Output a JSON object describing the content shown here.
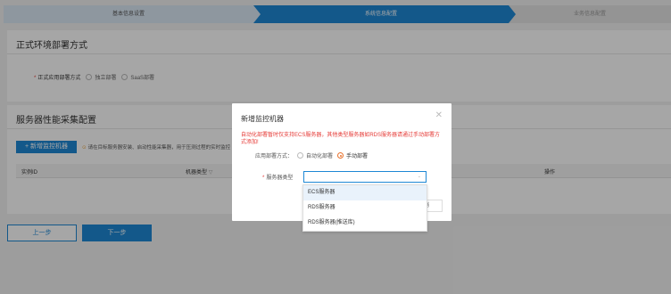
{
  "stepper": {
    "steps": [
      "基本信息设置",
      "系统信息配置",
      "业务信息配置"
    ]
  },
  "section1": {
    "title": "正式环境部署方式",
    "field_label": "正式应用部署方式",
    "options": [
      "独立部署",
      "SaaS部署"
    ]
  },
  "section2": {
    "title": "服务器性能采集配置",
    "add_button": "+ 新增监控机器",
    "note": "请在目标服务器安装、启动性能采集器，用于压测过程的实时监控",
    "columns": [
      "实例ID",
      "机器类型",
      "操作"
    ]
  },
  "footer": {
    "prev": "上一步",
    "next": "下一步"
  },
  "modal": {
    "title": "新增监控机器",
    "warning": "自动化部署暂时仅支持ECS服务器，其他类型服务器如RDS服务器请通过手动部署方式添加!",
    "deploy_label": "应用部署方式：",
    "deploy_options": [
      "自动化部署",
      "手动部署"
    ],
    "deploy_selected": "手动部署",
    "server_type_label": "服务器类型",
    "partial_button": "消",
    "dropdown": [
      "ECS服务器",
      "RDS服务器",
      "RDS服务器(推送库)"
    ]
  },
  "colors": {
    "primary": "#1e88d5",
    "warning_text": "#e53935",
    "radio_active": "#e8702a"
  }
}
